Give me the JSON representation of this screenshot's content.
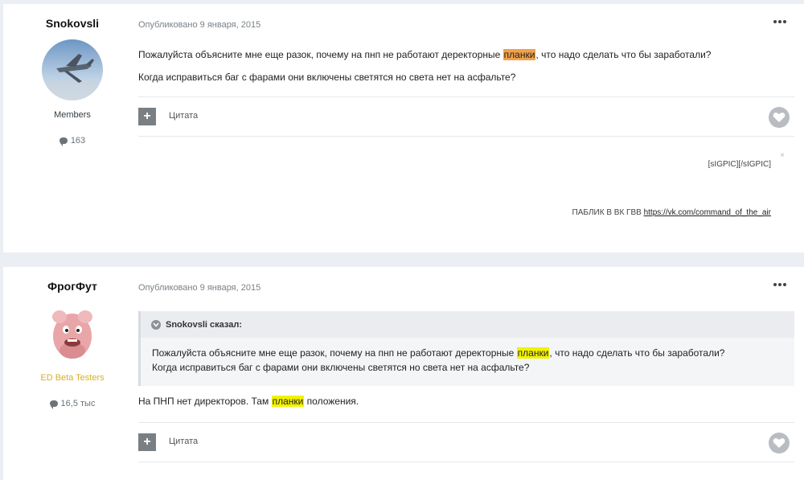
{
  "posts": [
    {
      "author": "Snokovsli",
      "group": "Members",
      "post_count": "163",
      "date": "Опубликовано 9 января, 2015",
      "lines": [
        {
          "before": "Пожалуйста объясните мне еще разок, почему на пнп не работают деректорные ",
          "highlight": "планки",
          "after": ", что надо сделать что бы заработали?"
        },
        {
          "text": "Когда исправиться баг с фарами они включены светятся но света нет на асфальте?"
        }
      ],
      "actions": {
        "plus": "+",
        "quote": "Цитата"
      },
      "signature": {
        "image_tag": "[sIGPIC][/sIGPIC]",
        "close": "×",
        "public_label": "ПАБЛИК В ВК ГВВ",
        "public_link": "https://vk.com/command_of_the_air"
      }
    },
    {
      "author": "ФрогФут",
      "group": "ED Beta Testers",
      "post_count": "16,5 тыс",
      "date": "Опубликовано 9 января, 2015",
      "quote": {
        "author": "Snokovsli сказал:",
        "line1_before": "Пожалуйста объясните мне еще разок, почему на пнп не работают деректорные ",
        "line1_highlight": "планки",
        "line1_after": ", что надо сделать что бы заработали?",
        "line2": "Когда исправиться баг с фарами они включены светятся но света нет на асфальте?"
      },
      "reply": {
        "before": "На ПНП нет директоров. Там ",
        "highlight": "планки",
        "after": " положения."
      },
      "actions": {
        "plus": "+",
        "quote": "Цитата"
      }
    }
  ],
  "colors": {
    "highlight_yellow": "#f2f200",
    "highlight_orange": "#f1a24a",
    "beta_group": "#d4b12a"
  }
}
